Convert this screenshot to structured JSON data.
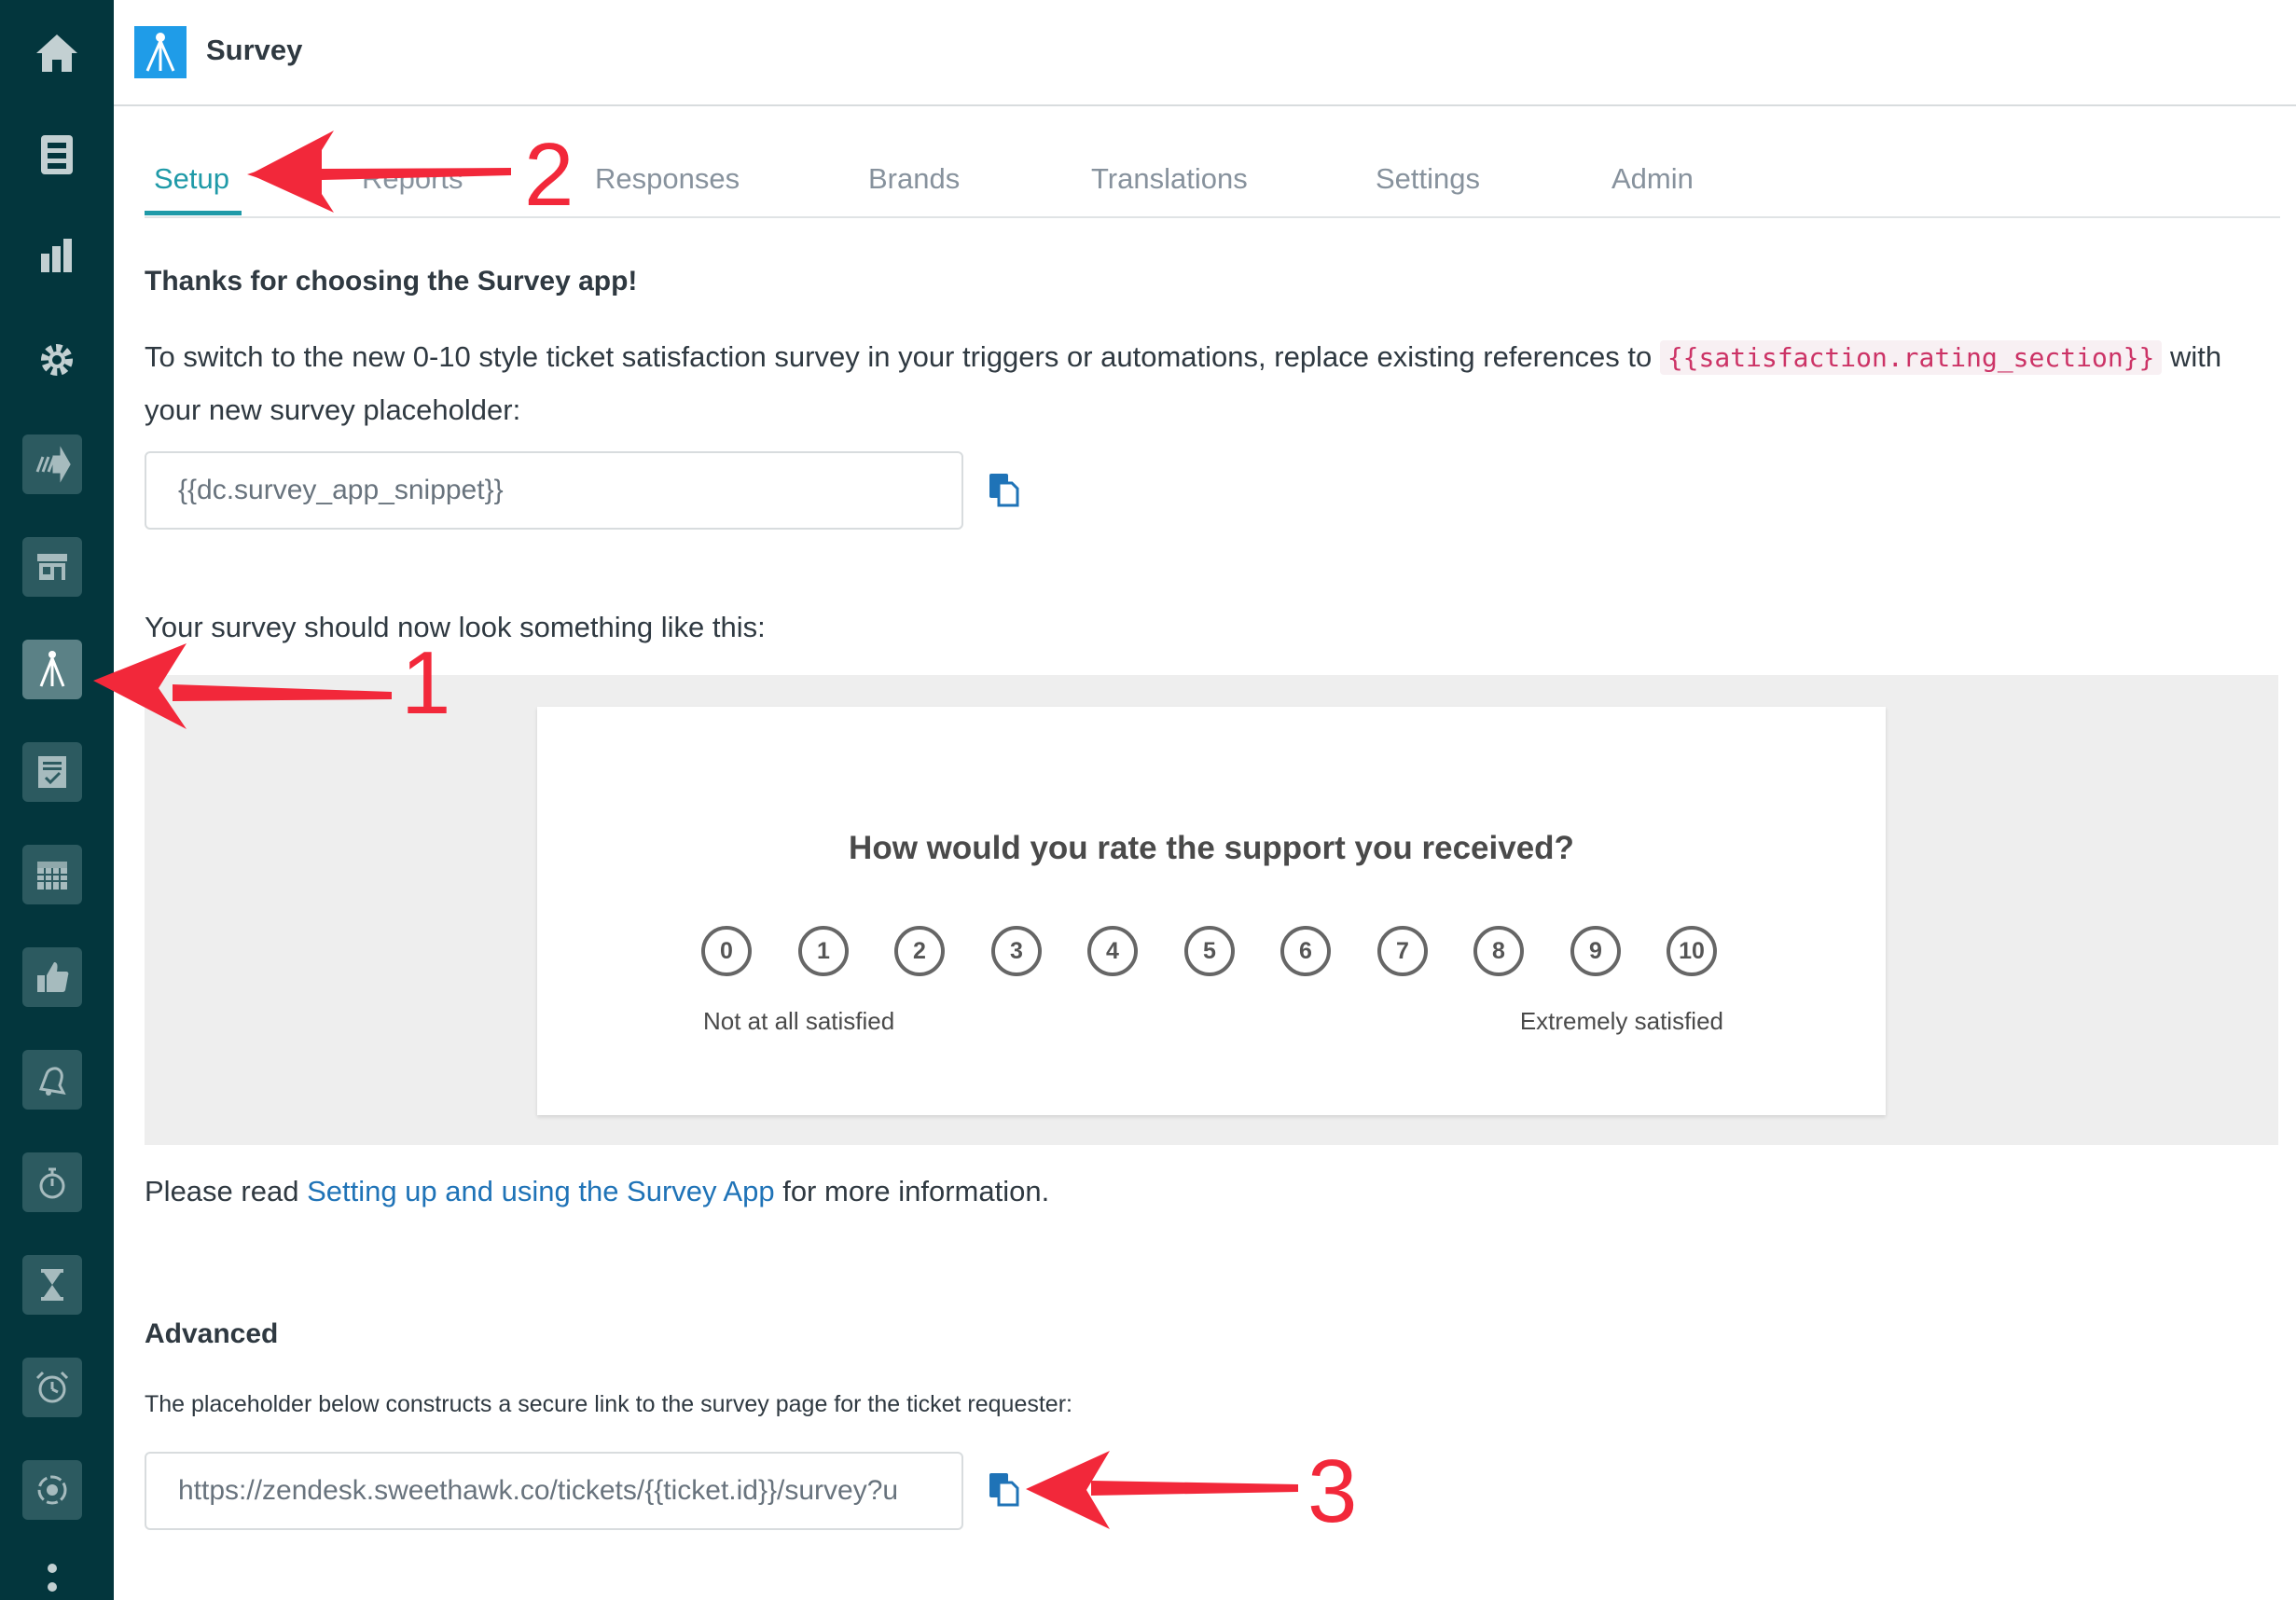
{
  "app": {
    "title": "Survey"
  },
  "sidebar": {
    "items": [
      {
        "icon": "home-icon"
      },
      {
        "icon": "views-icon"
      },
      {
        "icon": "reporting-icon"
      },
      {
        "icon": "admin-gear-icon"
      },
      {
        "icon": "forward-app-icon"
      },
      {
        "icon": "shop-app-icon"
      },
      {
        "icon": "survey-app-icon",
        "active": true
      },
      {
        "icon": "checklist-app-icon"
      },
      {
        "icon": "calendar-app-icon"
      },
      {
        "icon": "thumbs-up-app-icon"
      },
      {
        "icon": "bell-app-icon"
      },
      {
        "icon": "timer-app-icon"
      },
      {
        "icon": "hourglass-app-icon"
      },
      {
        "icon": "alarm-clock-app-icon"
      },
      {
        "icon": "sync-app-icon"
      }
    ]
  },
  "tabs": [
    {
      "label": "Setup",
      "active": true
    },
    {
      "label": "Reports"
    },
    {
      "label": "Responses"
    },
    {
      "label": "Brands"
    },
    {
      "label": "Translations"
    },
    {
      "label": "Settings"
    },
    {
      "label": "Admin"
    }
  ],
  "setup": {
    "heading": "Thanks for choosing the Survey app!",
    "intro_before": "To switch to the new 0-10 style ticket satisfaction survey in your triggers or automations, replace existing references to ",
    "placeholder_code": "{{satisfaction.rating_section}}",
    "intro_after": " with your new survey placeholder:",
    "snippet_value": "{{dc.survey_app_snippet}}",
    "preview_label": "Your survey should now look something like this:",
    "survey_preview": {
      "question": "How would you rate the support you received?",
      "scale": [
        "0",
        "1",
        "2",
        "3",
        "4",
        "5",
        "6",
        "7",
        "8",
        "9",
        "10"
      ],
      "low_label": "Not at all satisfied",
      "high_label": "Extremely satisfied"
    },
    "read_before": "Please read ",
    "read_link": "Setting up and using the Survey App",
    "read_after": " for more information.",
    "advanced_heading": "Advanced",
    "advanced_description": "The placeholder below constructs a secure link to the survey page for the ticket requester:",
    "link_value": "https://zendesk.sweethawk.co/tickets/{{ticket.id}}/survey?u"
  },
  "annotations": {
    "callout_1": "1",
    "callout_2": "2",
    "callout_3": "3"
  },
  "colors": {
    "sidebar_bg": "#03363d",
    "tab_active": "#1f9aa8",
    "link": "#1f73b7",
    "code": "#cc3366",
    "callout": "#f2283a",
    "app_logo": "#1f9ce8"
  }
}
